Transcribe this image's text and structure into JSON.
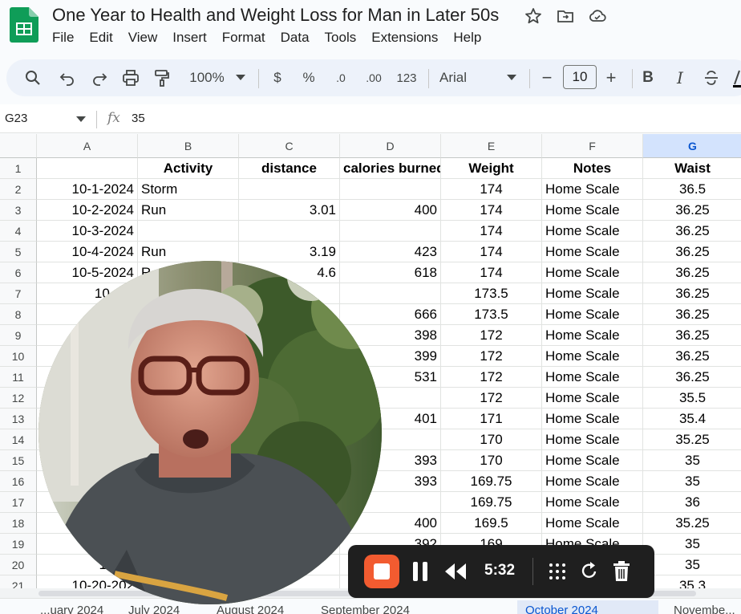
{
  "document": {
    "title": "One Year to Health and Weight Loss for Man in Later 50s",
    "menu": [
      "File",
      "Edit",
      "View",
      "Insert",
      "Format",
      "Data",
      "Tools",
      "Extensions",
      "Help"
    ]
  },
  "toolbar": {
    "zoom": "100%",
    "currency": "$",
    "percent": "%",
    "decrease_decimal": ".0",
    "increase_decimal": ".00",
    "number_format": "123",
    "font": "Arial",
    "font_size": "10",
    "bold": "B",
    "italic": "I",
    "minus": "−",
    "plus": "+"
  },
  "formula_bar": {
    "cell_ref": "G23",
    "fx": "fx",
    "value": "35"
  },
  "grid": {
    "columns": [
      "A",
      "B",
      "C",
      "D",
      "E",
      "F",
      "G"
    ],
    "selected_column": "G",
    "rows": [
      {
        "num": "1",
        "cells": [
          "",
          "Activity",
          "distance",
          "calories burned",
          "Weight",
          "Notes",
          "Waist"
        ]
      },
      {
        "num": "2",
        "cells": [
          "10-1-2024",
          "Storm",
          "",
          "",
          "174",
          "Home Scale",
          "36.5"
        ]
      },
      {
        "num": "3",
        "cells": [
          "10-2-2024",
          "Run",
          "3.01",
          "400",
          "174",
          "Home Scale",
          "36.25"
        ]
      },
      {
        "num": "4",
        "cells": [
          "10-3-2024",
          "",
          "",
          "",
          "174",
          "Home Scale",
          "36.25"
        ]
      },
      {
        "num": "5",
        "cells": [
          "10-4-2024",
          "Run",
          "3.19",
          "423",
          "174",
          "Home Scale",
          "36.25"
        ]
      },
      {
        "num": "6",
        "cells": [
          "10-5-2024",
          "R",
          "4.6",
          "618",
          "174",
          "Home Scale",
          "36.25"
        ]
      },
      {
        "num": "7",
        "cells": [
          "10-6-2",
          "",
          "",
          "",
          "173.5",
          "Home Scale",
          "36.25"
        ]
      },
      {
        "num": "8",
        "cells": [
          "10",
          "",
          "",
          "666",
          "173.5",
          "Home Scale",
          "36.25"
        ]
      },
      {
        "num": "9",
        "cells": [
          "",
          "",
          "",
          "398",
          "172",
          "Home Scale",
          "36.25"
        ]
      },
      {
        "num": "10",
        "cells": [
          "",
          "",
          "",
          "399",
          "172",
          "Home Scale",
          "36.25"
        ]
      },
      {
        "num": "11",
        "cells": [
          "",
          "",
          "",
          "531",
          "172",
          "Home Scale",
          "36.25"
        ]
      },
      {
        "num": "12",
        "cells": [
          "",
          "",
          "",
          "",
          "172",
          "Home Scale",
          "35.5"
        ]
      },
      {
        "num": "13",
        "cells": [
          "",
          "",
          "",
          "401",
          "171",
          "Home Scale",
          "35.4"
        ]
      },
      {
        "num": "14",
        "cells": [
          "",
          "",
          "",
          "",
          "170",
          "Home Scale",
          "35.25"
        ]
      },
      {
        "num": "15",
        "cells": [
          "",
          "",
          "",
          "393",
          "170",
          "Home Scale",
          "35"
        ]
      },
      {
        "num": "16",
        "cells": [
          "",
          "",
          "",
          "393",
          "169.75",
          "Home Scale",
          "35"
        ]
      },
      {
        "num": "17",
        "cells": [
          "",
          "",
          "",
          "",
          "169.75",
          "Home Scale",
          "36"
        ]
      },
      {
        "num": "18",
        "cells": [
          "",
          "",
          "",
          "400",
          "169.5",
          "Home Scale",
          "35.25"
        ]
      },
      {
        "num": "19",
        "cells": [
          "10",
          "",
          "",
          "392",
          "169",
          "Home Scale",
          "35"
        ]
      },
      {
        "num": "20",
        "cells": [
          "10-19",
          "",
          "",
          "",
          "",
          "",
          "35"
        ]
      },
      {
        "num": "21",
        "cells": [
          "10-20-202",
          "",
          "",
          "",
          "",
          "",
          "35.3"
        ]
      }
    ]
  },
  "sheets": [
    "...uary 2024",
    "July 2024",
    "August 2024",
    "September 2024",
    "October 2024",
    "Novembe..."
  ],
  "active_sheet": "October 2024",
  "recorder": {
    "elapsed": "5:32"
  },
  "colors": {
    "accent": "#0b57d0",
    "recorder_stop": "#f25b30",
    "sheets_green": "#0f9d58"
  }
}
